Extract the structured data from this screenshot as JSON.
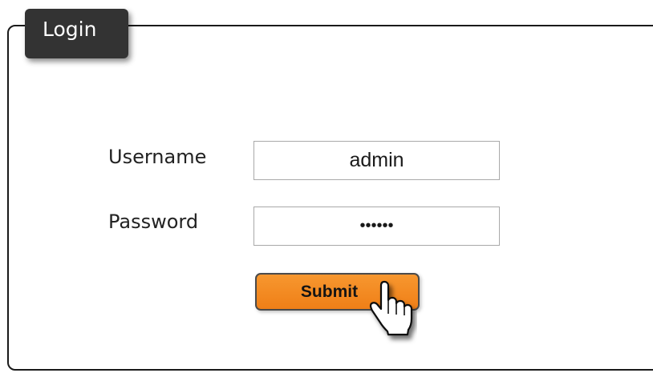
{
  "login": {
    "title": "Login",
    "username_label": "Username",
    "username_value": "admin",
    "password_label": "Password",
    "password_mask": "••••••",
    "submit_label": "Submit"
  },
  "colors": {
    "tab_background": "#333333",
    "button_orange": "#f28a23",
    "border": "#1a1a1a"
  },
  "icons": {
    "cursor": "hand-pointer-icon"
  }
}
